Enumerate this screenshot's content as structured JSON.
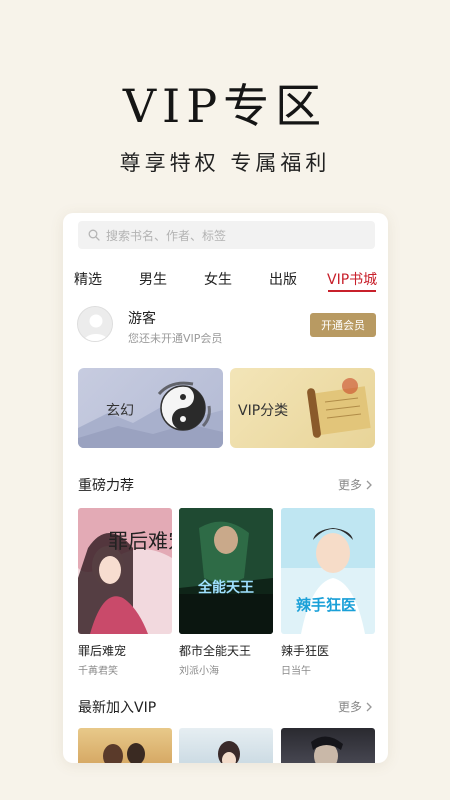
{
  "hero": {
    "title": "VIP专区",
    "subtitle": "尊享特权 专属福利"
  },
  "search": {
    "placeholder": "搜索书名、作者、标签"
  },
  "tabs": [
    {
      "label": "精选"
    },
    {
      "label": "男生"
    },
    {
      "label": "女生"
    },
    {
      "label": "出版"
    },
    {
      "label": "VIP书城",
      "active": true
    }
  ],
  "user": {
    "name": "游客",
    "status": "您还未开通VIP会员",
    "button": "开通会员"
  },
  "banners": [
    {
      "label": "玄幻"
    },
    {
      "label": "VIP分类"
    }
  ],
  "featured": {
    "title": "重磅力荐",
    "more": "更多",
    "books": [
      {
        "title": "罪后难宠",
        "author": "千苒君笑",
        "cover_text": "罪后难宠"
      },
      {
        "title": "都市全能天王",
        "author": "刘派小海",
        "cover_text": "全能天王"
      },
      {
        "title": "辣手狂医",
        "author": "日当午",
        "cover_text": "辣手狂医"
      }
    ]
  },
  "latest": {
    "title": "最新加入VIP",
    "more": "更多"
  },
  "colors": {
    "accent": "#c8202b",
    "gold": "#b89a62",
    "background": "#f7f3ea"
  }
}
